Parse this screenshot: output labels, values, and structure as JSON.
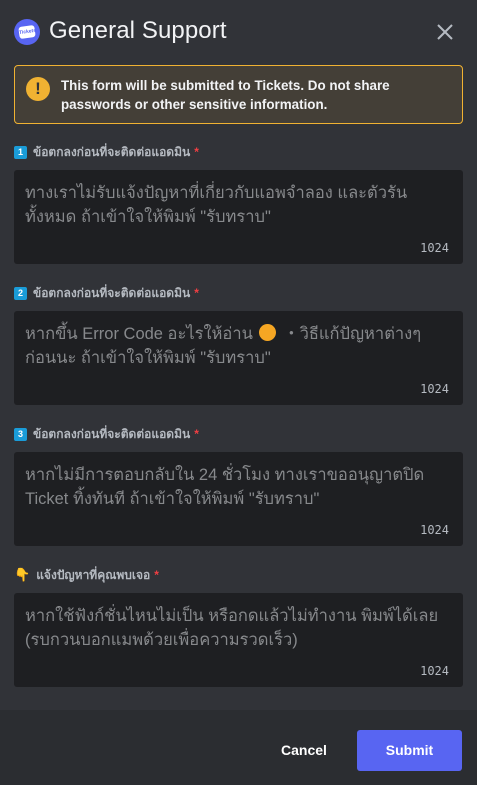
{
  "header": {
    "title": "General Support",
    "app_icon_text": "Tickets"
  },
  "notice": {
    "text_prefix": "This form will be submitted to ",
    "bot_name": "Tickets",
    "text_suffix": ". Do not share passwords or other sensitive information."
  },
  "fields": [
    {
      "number": "1",
      "label": "ข้อตกลงก่อนที่จะติดต่อแอดมิน",
      "required": "*",
      "placeholder": "ทางเราไม่รับแจ้งปัญหาที่เกี่ยวกับแอพจำลอง และตัวรันทั้งหมด ถ้าเข้าใจให้พิมพ์ \"รับทราบ\"",
      "max_length": "1024"
    },
    {
      "number": "2",
      "label": "ข้อตกลงก่อนที่จะติดต่อแอดมิน",
      "required": "*",
      "placeholder_a": "หากขึ้น Error Code อะไรให้อ่าน",
      "placeholder_b": "・วิธีแก้ปัญหาต่างๆก่อนนะ ถ้าเข้าใจให้พิมพ์ \"รับทราบ\"",
      "max_length": "1024"
    },
    {
      "number": "3",
      "label": "ข้อตกลงก่อนที่จะติดต่อแอดมิน",
      "required": "*",
      "placeholder": "หากไม่มีการตอบกลับใน 24 ชั่วโมง ทางเราขออนุญาตปิด Ticket ทิ้งทันที ถ้าเข้าใจให้พิมพ์ \"รับทราบ\"",
      "max_length": "1024"
    },
    {
      "icon": "👇",
      "label": "แจ้งปัญหาที่คุณพบเจอ",
      "required": "*",
      "placeholder": "หากใช้ฟังก์ชั่นไหนไม่เป็น หรือกดแล้วไม่ทำงาน พิมพ์ได้เลย (รบกวนบอกแมพด้วยเพื่อความรวดเร็ว)",
      "max_length": "1024"
    }
  ],
  "footer": {
    "cancel_label": "Cancel",
    "submit_label": "Submit"
  },
  "colors": {
    "background": "#313338",
    "footer": "#2b2d31",
    "input": "#1e1f22",
    "accent": "#5865f2",
    "warning": "#f0b232",
    "required": "#f23f43"
  },
  "icons": [
    "app-icon",
    "close-icon",
    "warning-icon",
    "keycap-number-icon",
    "pointing-down-icon",
    "face-emoji-icon"
  ]
}
